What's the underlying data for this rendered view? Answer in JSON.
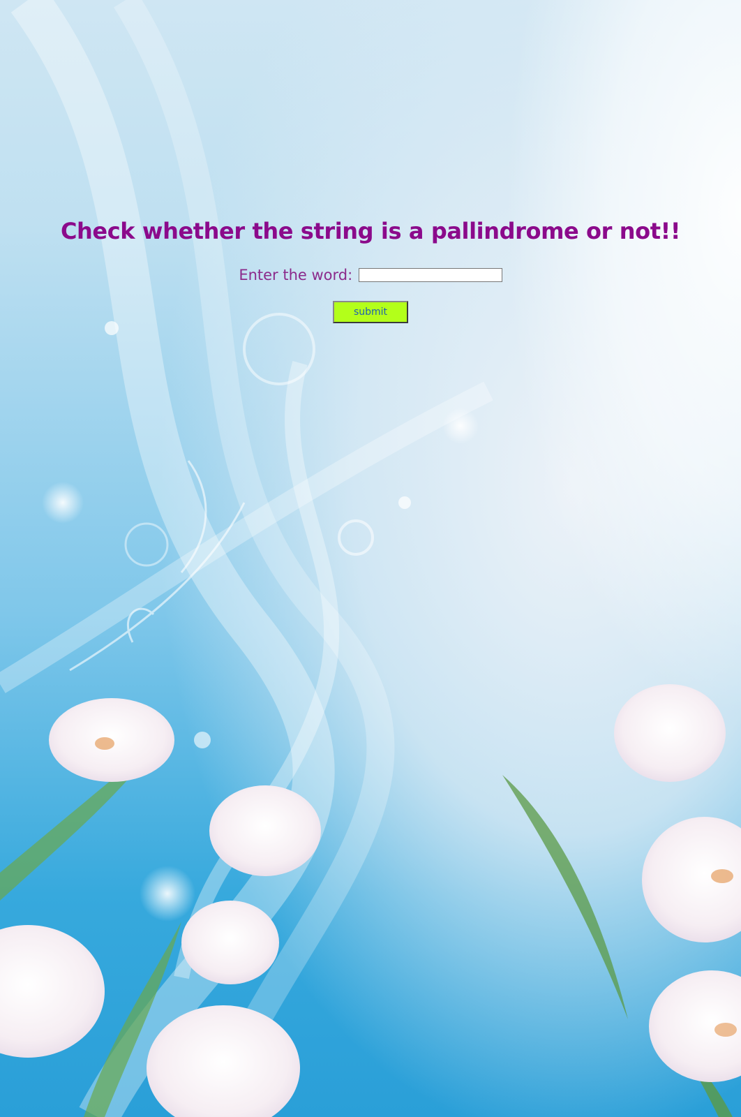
{
  "page": {
    "heading": "Check whether the string is a pallindrome or not!!",
    "form": {
      "word_label": "Enter the word:",
      "word_value": "",
      "submit_label": "submit"
    }
  },
  "colors": {
    "heading": "#8b0a8b",
    "label": "#8b2a8b",
    "button_bg": "#b3ff1a",
    "button_text": "#1f5fb0"
  },
  "background": {
    "description_icon": "floral-background"
  }
}
